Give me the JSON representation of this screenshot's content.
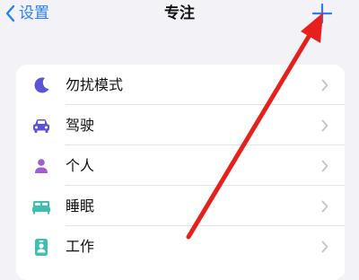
{
  "nav": {
    "back_label": "设置",
    "title": "专注",
    "add_icon": "plus-icon",
    "back_icon": "chevron-left-icon"
  },
  "colors": {
    "background": "#f2f2f7",
    "card": "#ffffff",
    "accent": "#2f7df6",
    "annotation_arrow": "#e8201c",
    "dnd_moon": "#5b54d6",
    "driving": "#5b54d6",
    "personal": "#a55bd6",
    "sleep": "#3fbfb0",
    "work": "#3fbfb0"
  },
  "focus_list": {
    "items": [
      {
        "label": "勿扰模式",
        "icon": "moon-icon"
      },
      {
        "label": "驾驶",
        "icon": "car-icon"
      },
      {
        "label": "个人",
        "icon": "person-icon"
      },
      {
        "label": "睡眠",
        "icon": "bed-icon"
      },
      {
        "label": "工作",
        "icon": "id-badge-icon"
      }
    ]
  }
}
